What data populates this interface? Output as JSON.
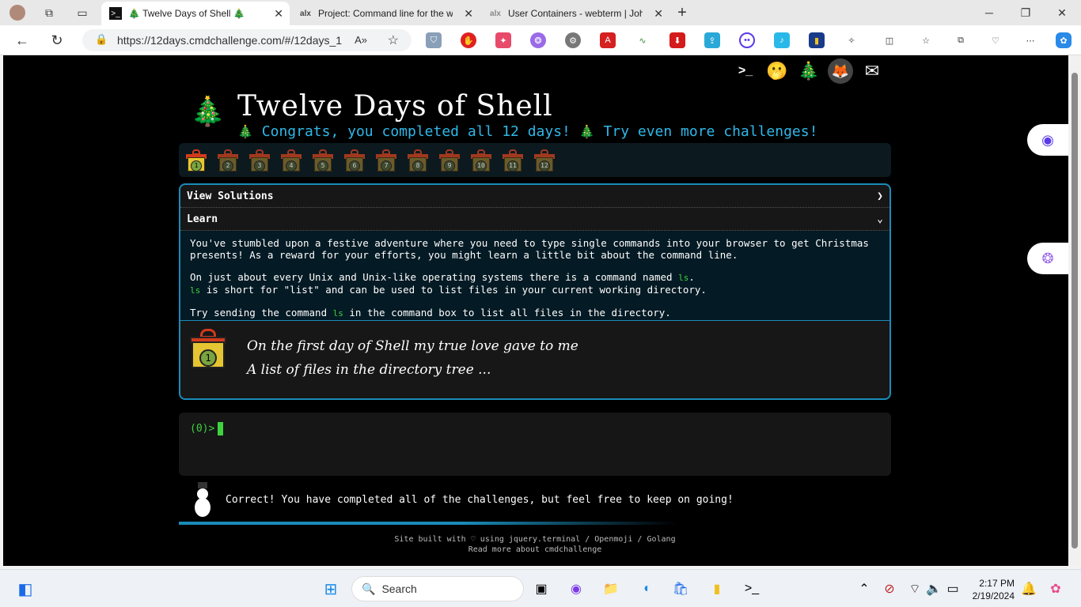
{
  "browser": {
    "tabs": [
      {
        "title": "Twelve Days of Shell",
        "active": true
      },
      {
        "title": "Project: Command line for the w",
        "active": false
      },
      {
        "title": "User Containers - webterm | Joha",
        "active": false
      }
    ],
    "url": "https://12days.cmdchallenge.com/#/12days_1",
    "new_tab_label": "+"
  },
  "page": {
    "title": "Twelve Days of Shell",
    "congrats_text": "Congrats, you completed all 12 days!",
    "try_more_text": "Try even more challenges!",
    "gifts": [
      "1",
      "2",
      "3",
      "4",
      "5",
      "6",
      "7",
      "8",
      "9",
      "10",
      "11",
      "12"
    ],
    "gifts_completed_marker": 1,
    "view_solutions_label": "View Solutions",
    "learn_label": "Learn",
    "learn": {
      "p1": "You've stumbled upon a festive adventure where you need to type single commands into your browser to get Christmas presents! As a reward for your efforts, you might learn a little bit about the command line.",
      "p2a": "On just about every Unix and Unix-like operating systems there is a command named",
      "p2cmd": "ls",
      "p2b": "is short for \"list\" and can be used to list files in your current working directory.",
      "p3a": "Try sending the command",
      "p3b": "in the command box to list all files in the directory."
    },
    "verse": {
      "gift_num": "1",
      "line1": "On the first day of Shell my true love gave to me",
      "line2": "A list of files in the directory tree ..."
    },
    "terminal_prompt": "(0)>",
    "status_message": "Correct! You have completed all of the challenges, but feel free to keep on going!",
    "footer_line1": "Site built with ♡ using jquery.terminal / Openmoji / Golang",
    "footer_line2": "Read more about cmdchallenge",
    "progress": 0.4
  },
  "taskbar": {
    "search_label": "Search",
    "time": "2:17 PM",
    "date": "2/19/2024"
  }
}
